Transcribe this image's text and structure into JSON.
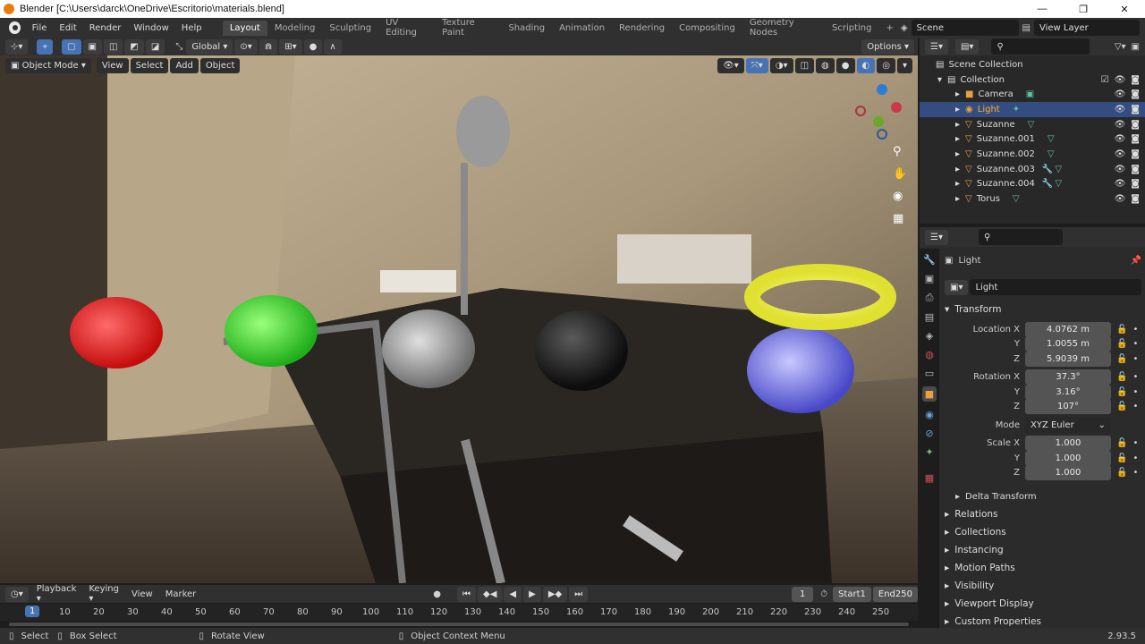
{
  "window": {
    "title": "Blender [C:\\Users\\darck\\OneDrive\\Escritorio\\materials.blend]",
    "minimize": "—",
    "maximize": "❐",
    "close": "✕"
  },
  "menu": [
    "File",
    "Edit",
    "Render",
    "Window",
    "Help"
  ],
  "workspaces": [
    "Layout",
    "Modeling",
    "Sculpting",
    "UV Editing",
    "Texture Paint",
    "Shading",
    "Animation",
    "Rendering",
    "Compositing",
    "Geometry Nodes",
    "Scripting"
  ],
  "active_workspace": "Layout",
  "scene": {
    "name": "Scene",
    "view_layer": "View Layer"
  },
  "viewport_header": {
    "orientation": "Global",
    "options": "Options"
  },
  "viewport_header2": {
    "mode": "Object Mode",
    "view": "View",
    "select": "Select",
    "add": "Add",
    "object": "Object"
  },
  "outliner": {
    "root": "Scene Collection",
    "collection": "Collection",
    "items": [
      {
        "name": "Camera",
        "type": "camera"
      },
      {
        "name": "Light",
        "type": "light",
        "selected": true
      },
      {
        "name": "Suzanne",
        "type": "mesh"
      },
      {
        "name": "Suzanne.001",
        "type": "mesh"
      },
      {
        "name": "Suzanne.002",
        "type": "mesh"
      },
      {
        "name": "Suzanne.003",
        "type": "mesh-mod"
      },
      {
        "name": "Suzanne.004",
        "type": "mesh-mod"
      },
      {
        "name": "Torus",
        "type": "mesh"
      }
    ]
  },
  "properties": {
    "object_name": "Light",
    "data_name": "Light",
    "transform": {
      "title": "Transform",
      "location_label": "Location X",
      "location": [
        "4.0762 m",
        "1.0055 m",
        "5.9039 m"
      ],
      "rotation_label": "Rotation X",
      "rotation": [
        "37.3°",
        "3.16°",
        "107°"
      ],
      "mode_label": "Mode",
      "mode": "XYZ Euler",
      "scale_label": "Scale X",
      "scale": [
        "1.000",
        "1.000",
        "1.000"
      ],
      "y": "Y",
      "z": "Z"
    },
    "delta": "Delta Transform",
    "panels": [
      "Relations",
      "Collections",
      "Instancing",
      "Motion Paths",
      "Visibility",
      "Viewport Display",
      "Custom Properties"
    ]
  },
  "timeline": {
    "playback": "Playback",
    "keying": "Keying",
    "view": "View",
    "marker": "Marker",
    "current_frame": "1",
    "start_label": "Start",
    "start": "1",
    "end_label": "End",
    "end": "250",
    "ticks": [
      "10",
      "20",
      "30",
      "40",
      "50",
      "60",
      "70",
      "80",
      "90",
      "100",
      "110",
      "120",
      "130",
      "140",
      "150",
      "160",
      "170",
      "180",
      "190",
      "200",
      "210",
      "220",
      "230",
      "240",
      "250"
    ],
    "cursor": "1"
  },
  "status": {
    "select": "Select",
    "box_select": "Box Select",
    "rotate": "Rotate View",
    "context": "Object Context Menu",
    "version": "2.93.5"
  },
  "colors": {
    "accent": "#334d80",
    "active_tab": "#474747",
    "orange": "#e87d0d"
  }
}
